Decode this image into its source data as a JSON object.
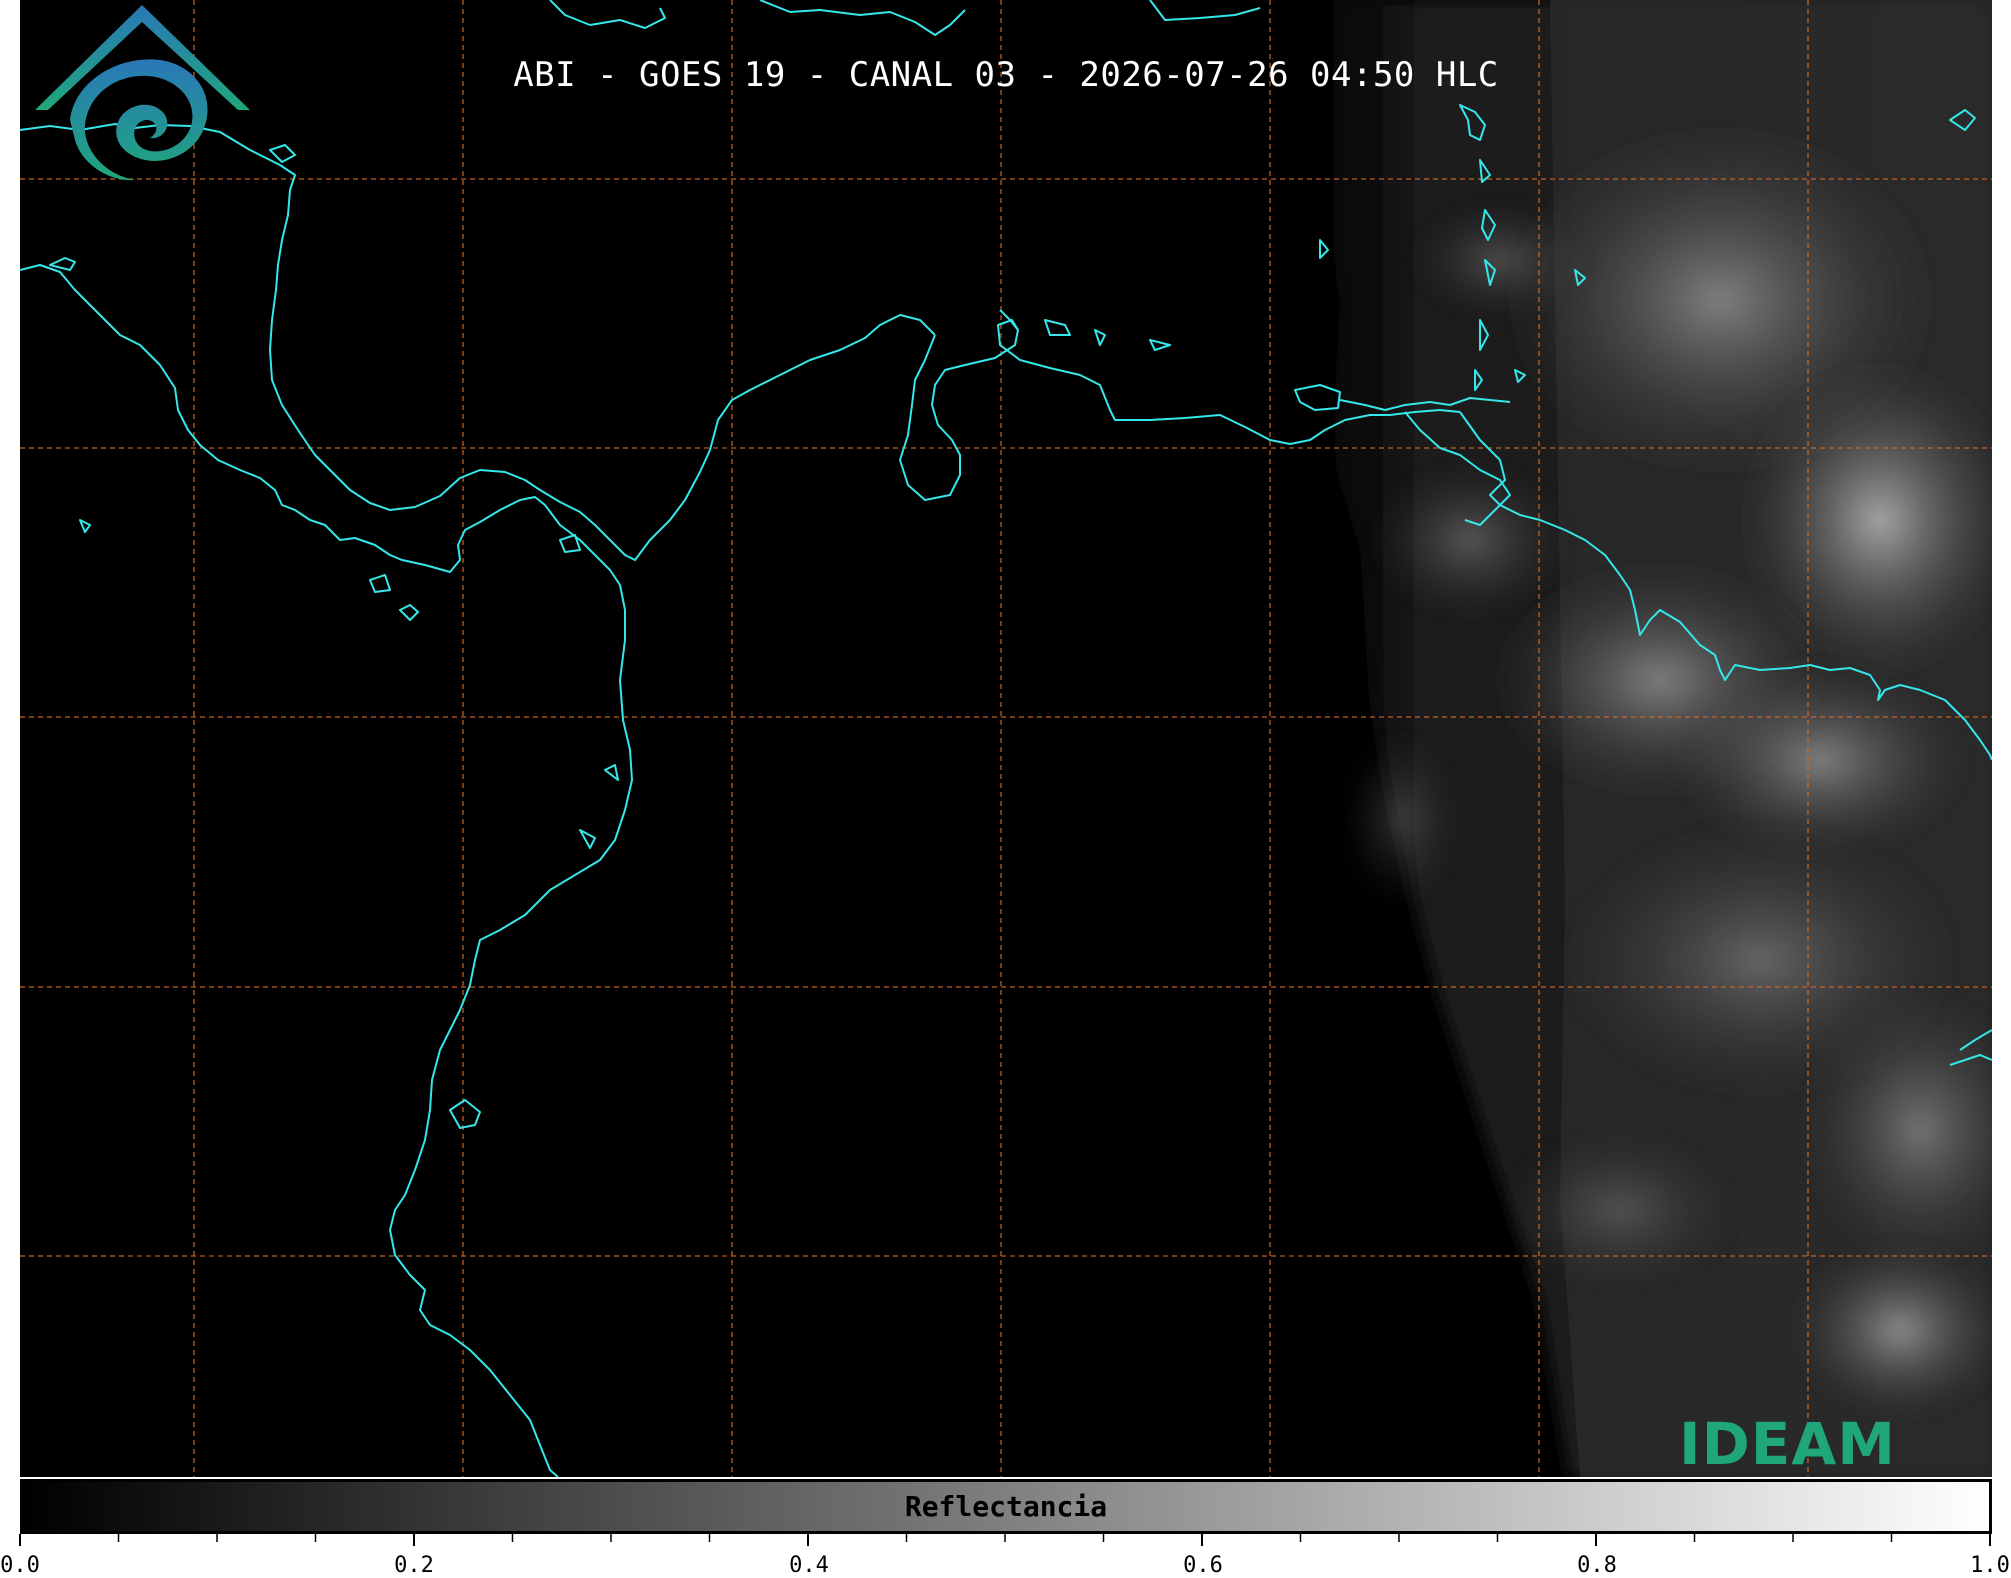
{
  "title": "ABI - GOES 19 - CANAL 03 - 2026-07-26 04:50 HLC",
  "colors": {
    "background": "#000000",
    "coastline": "#35e6ea",
    "gridline": "#d36a25",
    "logo_blue": "#2a78b8",
    "logo_teal": "#1fa77b"
  },
  "icons": [
    "ideam-logo-icon"
  ],
  "logo": {
    "text": "IDEAM"
  },
  "colorbar": {
    "label": "Reflectancia",
    "range": [
      0.0,
      1.0
    ],
    "tick_labels": [
      "0.0",
      "0.2",
      "0.4",
      "0.6",
      "0.8",
      "1.0"
    ],
    "colormap": "grayscale"
  },
  "map": {
    "grid": "dashed",
    "coastlines": true,
    "cloud_side": "right"
  }
}
